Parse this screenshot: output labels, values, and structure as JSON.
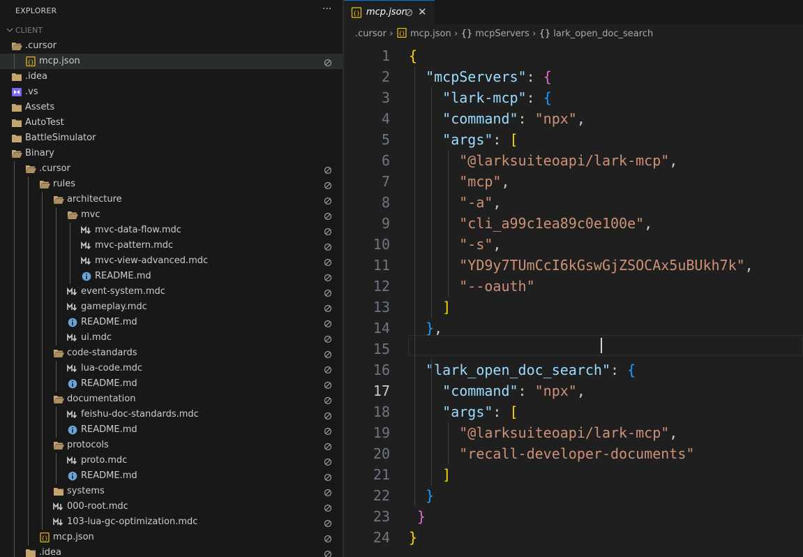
{
  "explorer": {
    "title": "EXPLORER",
    "more_icon": "ellipsis-icon",
    "section_title": "CLIENT"
  },
  "tree": [
    {
      "label": ".cursor",
      "icon": "folder-open-icon",
      "depth": 0
    },
    {
      "label": "mcp.json",
      "icon": "json-file-icon",
      "depth": 1,
      "selected": true,
      "tag": "lock-icon"
    },
    {
      "label": ".idea",
      "icon": "folder-icon",
      "depth": 0
    },
    {
      "label": ".vs",
      "icon": "visualstudio-folder-icon",
      "depth": 0
    },
    {
      "label": "Assets",
      "icon": "folder-icon",
      "depth": 0
    },
    {
      "label": "AutoTest",
      "icon": "folder-icon",
      "depth": 0
    },
    {
      "label": "BattleSimulator",
      "icon": "folder-icon",
      "depth": 0
    },
    {
      "label": "Binary",
      "icon": "folder-open-icon",
      "depth": 0
    },
    {
      "label": ".cursor",
      "icon": "folder-open-icon",
      "depth": 1,
      "tag": "lock-icon"
    },
    {
      "label": "rules",
      "icon": "folder-open-icon",
      "depth": 2,
      "tag": "lock-icon"
    },
    {
      "label": "architecture",
      "icon": "folder-open-icon",
      "depth": 3,
      "tag": "lock-icon"
    },
    {
      "label": "mvc",
      "icon": "folder-open-icon",
      "depth": 4,
      "tag": "lock-icon"
    },
    {
      "label": "mvc-data-flow.mdc",
      "icon": "markdown-icon",
      "depth": 5,
      "tag": "lock-icon"
    },
    {
      "label": "mvc-pattern.mdc",
      "icon": "markdown-icon",
      "depth": 5,
      "tag": "lock-icon"
    },
    {
      "label": "mvc-view-advanced.mdc",
      "icon": "markdown-icon",
      "depth": 5,
      "tag": "lock-icon"
    },
    {
      "label": "README.md",
      "icon": "info-icon",
      "depth": 5,
      "tag": "lock-icon"
    },
    {
      "label": "event-system.mdc",
      "icon": "markdown-icon",
      "depth": 4,
      "tag": "lock-icon"
    },
    {
      "label": "gameplay.mdc",
      "icon": "markdown-icon",
      "depth": 4,
      "tag": "lock-icon"
    },
    {
      "label": "README.md",
      "icon": "info-icon",
      "depth": 4,
      "tag": "lock-icon"
    },
    {
      "label": "ui.mdc",
      "icon": "markdown-icon",
      "depth": 4,
      "tag": "lock-icon"
    },
    {
      "label": "code-standards",
      "icon": "folder-open-icon",
      "depth": 3,
      "tag": "lock-icon"
    },
    {
      "label": "lua-code.mdc",
      "icon": "markdown-icon",
      "depth": 4,
      "tag": "lock-icon"
    },
    {
      "label": "README.md",
      "icon": "info-icon",
      "depth": 4,
      "tag": "lock-icon"
    },
    {
      "label": "documentation",
      "icon": "folder-open-icon",
      "depth": 3,
      "tag": "lock-icon"
    },
    {
      "label": "feishu-doc-standards.mdc",
      "icon": "markdown-icon",
      "depth": 4,
      "tag": "lock-icon"
    },
    {
      "label": "README.md",
      "icon": "info-icon",
      "depth": 4,
      "tag": "lock-icon"
    },
    {
      "label": "protocols",
      "icon": "folder-open-icon",
      "depth": 3,
      "tag": "lock-icon"
    },
    {
      "label": "proto.mdc",
      "icon": "markdown-icon",
      "depth": 4,
      "tag": "lock-icon"
    },
    {
      "label": "README.md",
      "icon": "info-icon",
      "depth": 4,
      "tag": "lock-icon"
    },
    {
      "label": "systems",
      "icon": "folder-icon",
      "depth": 3,
      "tag": "lock-icon"
    },
    {
      "label": "000-root.mdc",
      "icon": "markdown-icon",
      "depth": 3,
      "tag": "lock-icon"
    },
    {
      "label": "103-lua-gc-optimization.mdc",
      "icon": "markdown-icon",
      "depth": 3,
      "tag": "lock-icon"
    },
    {
      "label": "mcp.json",
      "icon": "json-file-icon",
      "depth": 2,
      "tag": "lock-icon"
    },
    {
      "label": ".idea",
      "icon": "folder-icon",
      "depth": 1,
      "tag": "lock-icon"
    }
  ],
  "tab": {
    "label": "mcp.json",
    "icon": "json-file-icon",
    "lock_icon": "lock-icon",
    "close_glyph": "✕"
  },
  "breadcrumb": [
    {
      "label": ".cursor",
      "icon": ""
    },
    {
      "label": "mcp.json",
      "icon": "json-file-icon"
    },
    {
      "label": "mcpServers",
      "icon": "braces-icon"
    },
    {
      "label": "lark_open_doc_search",
      "icon": "braces-icon"
    }
  ],
  "editor": {
    "current_line": 17,
    "lines": [
      {
        "n": "1",
        "tokens": [
          [
            "b1",
            "{"
          ]
        ]
      },
      {
        "n": "2",
        "tokens": [
          [
            "p",
            "  "
          ],
          [
            "k",
            "\"mcpServers\""
          ],
          [
            "p",
            ": "
          ],
          [
            "b2",
            "{"
          ]
        ]
      },
      {
        "n": "3",
        "tokens": [
          [
            "p",
            "    "
          ],
          [
            "k",
            "\"lark-mcp\""
          ],
          [
            "p",
            ": "
          ],
          [
            "b3",
            "{"
          ]
        ]
      },
      {
        "n": "4",
        "tokens": [
          [
            "p",
            "    "
          ],
          [
            "k",
            "\"command\""
          ],
          [
            "p",
            ": "
          ],
          [
            "s",
            "\"npx\""
          ],
          [
            "p",
            ","
          ]
        ]
      },
      {
        "n": "5",
        "tokens": [
          [
            "p",
            "    "
          ],
          [
            "k",
            "\"args\""
          ],
          [
            "p",
            ": "
          ],
          [
            "b1",
            "["
          ]
        ]
      },
      {
        "n": "6",
        "tokens": [
          [
            "p",
            "      "
          ],
          [
            "s",
            "\"@larksuiteoapi/lark-mcp\""
          ],
          [
            "p",
            ","
          ]
        ]
      },
      {
        "n": "7",
        "tokens": [
          [
            "p",
            "      "
          ],
          [
            "s",
            "\"mcp\""
          ],
          [
            "p",
            ","
          ]
        ]
      },
      {
        "n": "8",
        "tokens": [
          [
            "p",
            "      "
          ],
          [
            "s",
            "\"-a\""
          ],
          [
            "p",
            ","
          ]
        ]
      },
      {
        "n": "9",
        "tokens": [
          [
            "p",
            "      "
          ],
          [
            "s",
            "\"cli_a99c1ea89c0e100e\""
          ],
          [
            "p",
            ","
          ]
        ]
      },
      {
        "n": "10",
        "tokens": [
          [
            "p",
            "      "
          ],
          [
            "s",
            "\"-s\""
          ],
          [
            "p",
            ","
          ]
        ]
      },
      {
        "n": "11",
        "tokens": [
          [
            "p",
            "      "
          ],
          [
            "s",
            "\"YD9y7TUmCcI6kGswGjZSOCAx5uBUkh7k\""
          ],
          [
            "p",
            ","
          ]
        ]
      },
      {
        "n": "12",
        "tokens": [
          [
            "p",
            "      "
          ],
          [
            "s",
            "\"--oauth\""
          ]
        ]
      },
      {
        "n": "13",
        "tokens": [
          [
            "p",
            "    "
          ],
          [
            "b1",
            "]"
          ]
        ]
      },
      {
        "n": "14",
        "tokens": [
          [
            "p",
            "  "
          ],
          [
            "b3",
            "}"
          ],
          [
            "p",
            ","
          ]
        ]
      },
      {
        "n": "15",
        "tokens": []
      },
      {
        "n": "16",
        "tokens": [
          [
            "p",
            "  "
          ],
          [
            "k",
            "\"lark_open_doc_search\""
          ],
          [
            "p",
            ": "
          ],
          [
            "b3",
            "{"
          ]
        ]
      },
      {
        "n": "17",
        "tokens": [
          [
            "p",
            "    "
          ],
          [
            "k",
            "\"command\""
          ],
          [
            "p",
            ": "
          ],
          [
            "s",
            "\"npx\""
          ],
          [
            "p",
            ","
          ]
        ]
      },
      {
        "n": "18",
        "tokens": [
          [
            "p",
            "    "
          ],
          [
            "k",
            "\"args\""
          ],
          [
            "p",
            ": "
          ],
          [
            "b1",
            "["
          ]
        ]
      },
      {
        "n": "19",
        "tokens": [
          [
            "p",
            "      "
          ],
          [
            "s",
            "\"@larksuiteoapi/lark-mcp\""
          ],
          [
            "p",
            ","
          ]
        ]
      },
      {
        "n": "20",
        "tokens": [
          [
            "p",
            "      "
          ],
          [
            "s",
            "\"recall-developer-documents\""
          ]
        ]
      },
      {
        "n": "21",
        "tokens": [
          [
            "p",
            "    "
          ],
          [
            "b1",
            "]"
          ]
        ]
      },
      {
        "n": "22",
        "tokens": [
          [
            "p",
            "  "
          ],
          [
            "b3",
            "}"
          ]
        ]
      },
      {
        "n": "23",
        "tokens": [
          [
            "p",
            " "
          ],
          [
            "b2",
            "}"
          ]
        ]
      },
      {
        "n": "24",
        "tokens": [
          [
            "b1",
            "}"
          ]
        ]
      }
    ]
  },
  "colors": {
    "accent": "#0078d4",
    "json_icon": "#f1c40f",
    "folder": "#c5a46e",
    "markdown": "#cccccc",
    "info": "#6ba4d6"
  }
}
